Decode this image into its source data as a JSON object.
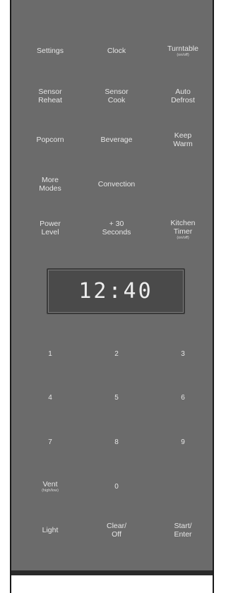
{
  "display": {
    "time": "12:40"
  },
  "buttons": {
    "settings": {
      "l1": "Settings"
    },
    "clock": {
      "l1": "Clock"
    },
    "turntable": {
      "l1": "Turntable",
      "sub": "(on/off)"
    },
    "sensor_reheat": {
      "l1": "Sensor",
      "l2": "Reheat"
    },
    "sensor_cook": {
      "l1": "Sensor",
      "l2": "Cook"
    },
    "auto_defrost": {
      "l1": "Auto",
      "l2": "Defrost"
    },
    "popcorn": {
      "l1": "Popcorn"
    },
    "beverage": {
      "l1": "Beverage"
    },
    "keep_warm": {
      "l1": "Keep",
      "l2": "Warm"
    },
    "more_modes": {
      "l1": "More",
      "l2": "Modes"
    },
    "convection": {
      "l1": "Convection"
    },
    "power_level": {
      "l1": "Power",
      "l2": "Level"
    },
    "plus30": {
      "l1": "+ 30",
      "l2": "Seconds"
    },
    "kitchen_timer": {
      "l1": "Kitchen",
      "l2": "Timer",
      "sub": "(on/off)"
    },
    "n1": {
      "l1": "1"
    },
    "n2": {
      "l1": "2"
    },
    "n3": {
      "l1": "3"
    },
    "n4": {
      "l1": "4"
    },
    "n5": {
      "l1": "5"
    },
    "n6": {
      "l1": "6"
    },
    "n7": {
      "l1": "7"
    },
    "n8": {
      "l1": "8"
    },
    "n9": {
      "l1": "9"
    },
    "vent": {
      "l1": "Vent",
      "sub": "(high/low)"
    },
    "n0": {
      "l1": "0"
    },
    "light": {
      "l1": "Light"
    },
    "clear_off": {
      "l1": "Clear/",
      "l2": "Off"
    },
    "start_enter": {
      "l1": "Start/",
      "l2": "Enter"
    }
  },
  "colors": {
    "panel": "#6b6b6b",
    "text": "#e6e6e6",
    "display_bg": "#4a4a4a"
  }
}
